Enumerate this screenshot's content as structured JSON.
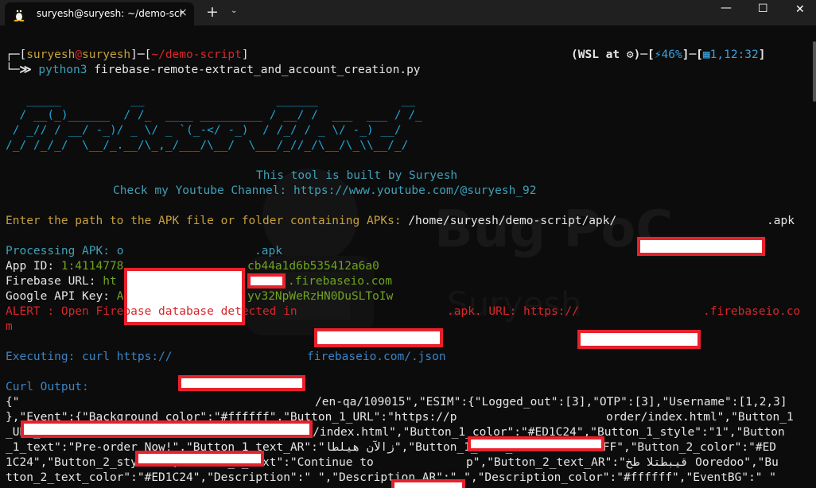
{
  "window": {
    "tab_title": "suryesh@suryesh: ~/demo-scr",
    "close_glyph": "×",
    "new_tab_glyph": "+",
    "dropdown_glyph": "⌄",
    "minimize_glyph": "—",
    "maximize_glyph": "☐",
    "close_window_glyph": "✕"
  },
  "prompt": {
    "corner_top": "┌─[",
    "user": "suryesh",
    "at": "@",
    "host": "suryesh",
    "sep1": "]─[",
    "path": "~/demo-script",
    "close": "]",
    "corner_bottom": "└─",
    "arrows": "≫",
    "command_name": "python3",
    "command_args": " firebase-remote-extract_and_account_creation.py",
    "right_wsl": "(WSL at ",
    "right_wsl_icon": "⚙",
    "right_sep": ")─[",
    "right_battery_icon": "⚡",
    "right_battery": "46%",
    "right_mid": "]─[",
    "right_cal_icon": "▦",
    "right_time": "1,12:32",
    "right_end": "]"
  },
  "banner": [
    "   _____          __                   ______            __",
    "  / __(_)______  / /_  ____ _________ / __/ /  ___  ___ / /_",
    " / _// / __/ -_)/ _ \\/ _ `(_-</ -_)  / /_/ / _ \\/ -_) __/",
    "/_/ /_/_/  \\__/_.__/\\_,_/___/\\__/  \\___/_//_/\\__/\\_\\\\__/_/"
  ],
  "info": {
    "built_by": "This tool is built by Suryesh",
    "channel": "Check my Youtube Channel: https://www.youtube.com/@suryesh_92"
  },
  "apk_prompt": {
    "label": "Enter the path to the APK file or folder containing APKs: ",
    "value_prefix": "/home/suryesh/demo-script/apk/",
    "value_suffix": ".apk"
  },
  "processing": {
    "label": "Processing APK: ",
    "value_tail": ".apk",
    "app_id_label": "App ID: ",
    "app_id_head": "1:4114778",
    "app_id_tail": "cb44a1d6b535412a6a0",
    "firebase_label": "Firebase URL: ",
    "firebase_head": "ht",
    "firebase_tail": ".firebaseio.com",
    "google_label": "Google API Key: ",
    "google_head": "A",
    "google_tail": "yv32NpWeRzHN0DuSLToIw",
    "alert_prefix": "ALERT : Open Firebase database detected in ",
    "alert_mid": ".apk. URL: https://",
    "alert_suffix": ".firebaseio.co",
    "alert_wrap": "m"
  },
  "executing": {
    "label": "Executing: curl https://",
    "suffix": "firebaseio.com/.json"
  },
  "curl": {
    "label": "Curl Output:",
    "lines": [
      "{\"",
      "/en-qa/109015\",\"ESIM\":{\"Logged_out\":[3],\"OTP\":[3],\"Username\":[1,2,3]",
      "},\"Event\":{\"Background_color\":\"#ffffff\",\"Button_1_URL\":\"https://p",
      "order/index.html\",\"Button_1",
      "_URL_AR\":\"https://",
      "a/order/index.html\",\"Button_1_color\":\"#ED1C24\",\"Button_1_style\":\"1\",\"Button",
      "_1_text\":\"Pre-order Now!\",\"Button_1_text_AR\":\"زالآن هيلطا\",\"Button_1_text_color\":\"#FFFFFF\",\"Button_2_color\":\"#ED",
      "1C24\",\"Button_2_style\":2,\"Button_2_text\":\"Continue to ",
      "p\",\"Button_2_text_AR\":\"قيبطتلا طخ Ooredoo\",\"Bu",
      "tton_2_text_color\":\"#ED1C24\",\"Description\":\" \",\"Description_AR\":\" \",\"Description_color\":\"#ffffff\",\"EventBG\":\" \""
    ]
  },
  "watermark": {
    "brand": "Bug PoC",
    "name": "Suryesh"
  }
}
